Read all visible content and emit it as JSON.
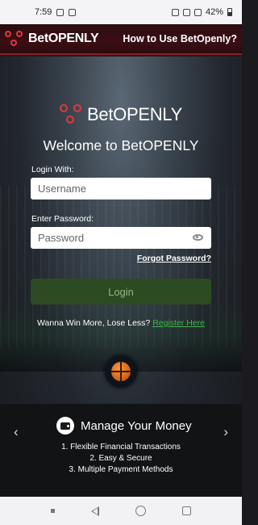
{
  "status_bar": {
    "time": "7:59",
    "battery": "42%"
  },
  "header": {
    "logo_prefix": "Bet",
    "logo_suffix": "OPENLY",
    "help_link": "How to Use BetOpenly?"
  },
  "login": {
    "welcome": "Welcome to BetOPENLY",
    "login_with_label": "Login With:",
    "username_placeholder": "Username",
    "password_label": "Enter Password:",
    "password_placeholder": "Password",
    "forgot_link": "Forgot Password?",
    "login_button": "Login",
    "register_prompt": "Wanna Win More, Lose Less?",
    "register_link": "Register Here"
  },
  "carousel": {
    "title": "Manage Your Money",
    "items": [
      "1. Flexible Financial Transactions",
      "2. Easy & Secure",
      "3. Multiple Payment Methods"
    ],
    "prev": "‹",
    "next": "›"
  },
  "icons": [
    "logo-icon",
    "basketball-icon",
    "wallet-icon",
    "eye-icon",
    "chevron-left-icon",
    "chevron-right-icon"
  ],
  "colors": {
    "brand_red": "#e0383f",
    "register_green": "#3fb54c",
    "login_button": "#2d4b22"
  }
}
